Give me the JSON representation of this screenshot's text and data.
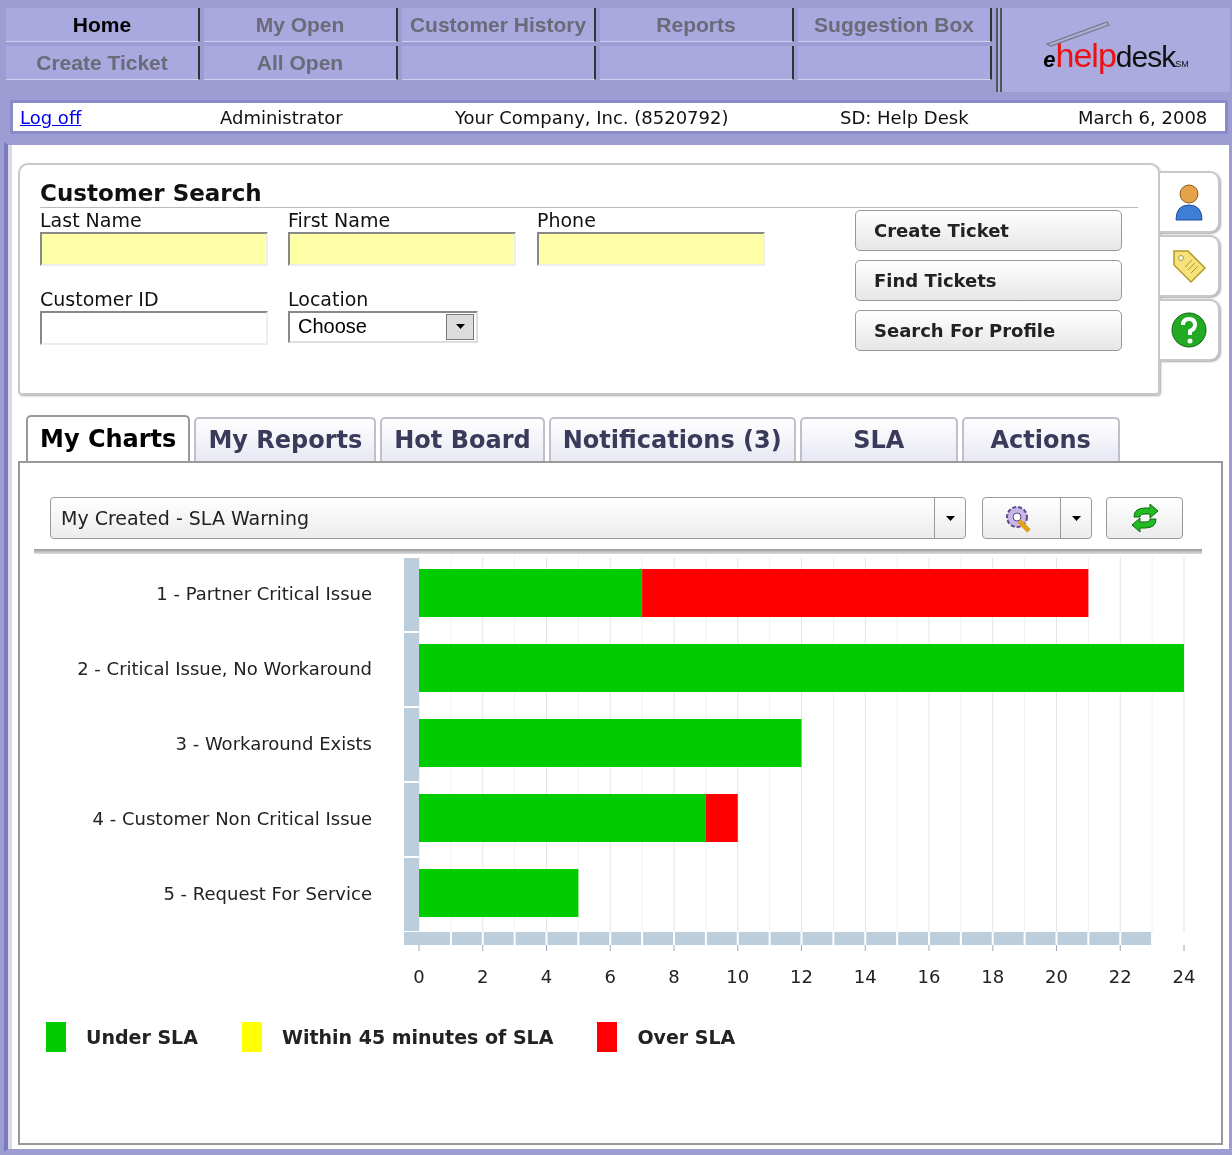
{
  "nav": {
    "rows": [
      [
        {
          "label": "Home",
          "selected": true
        },
        {
          "label": "My Open",
          "selected": false
        },
        {
          "label": "Customer History",
          "selected": false
        },
        {
          "label": "Reports",
          "selected": false
        },
        {
          "label": "Suggestion Box",
          "selected": false
        }
      ],
      [
        {
          "label": "Create Ticket",
          "selected": false
        },
        {
          "label": "All Open",
          "selected": false
        },
        null,
        null,
        null
      ]
    ],
    "logo": {
      "prefix": "e",
      "main": "help",
      "suffix": "desk",
      "mark": "SM"
    }
  },
  "info_bar": {
    "logoff": "Log off",
    "user": "Administrator",
    "company": "Your Company, Inc. (8520792)",
    "desk": "SD: Help Desk",
    "date": "March 6, 2008"
  },
  "customer_search": {
    "title": "Customer Search",
    "fields": [
      {
        "label": "Last Name",
        "kind": "text",
        "highlighted": true
      },
      {
        "label": "First Name",
        "kind": "text",
        "highlighted": true
      },
      {
        "label": "Phone",
        "kind": "text",
        "highlighted": true
      },
      {
        "label": "Customer ID",
        "kind": "text",
        "highlighted": false
      },
      {
        "label": "Location",
        "kind": "select",
        "value": "Choose",
        "highlighted": false
      }
    ],
    "buttons": [
      "Create Ticket",
      "Find Tickets",
      "Search For Profile"
    ]
  },
  "side_tabs": [
    {
      "kind": "person"
    },
    {
      "kind": "tag"
    },
    {
      "kind": "help"
    }
  ],
  "tabs": [
    {
      "label": "My Charts",
      "selected": true
    },
    {
      "label": "My Reports",
      "selected": false
    },
    {
      "label": "Hot Board",
      "selected": false
    },
    {
      "label": "Notifications (3)",
      "selected": false
    },
    {
      "label": "SLA",
      "selected": false
    },
    {
      "label": "Actions",
      "selected": false
    }
  ],
  "chart_select": {
    "value": "My Created - SLA Warning"
  },
  "chart_data": {
    "type": "bar",
    "orientation": "horizontal",
    "stacked": true,
    "grid": true,
    "categories": [
      "1 - Partner Critical Issue",
      "2 - Critical Issue, No Workaround",
      "3 - Workaround Exists",
      "4 - Customer Non Critical Issue",
      "5 - Request For Service"
    ],
    "series": [
      {
        "name": "Under SLA",
        "color": "#00cc00",
        "values": [
          7,
          24,
          12,
          9,
          5
        ]
      },
      {
        "name": "Within 45 minutes of SLA",
        "color": "#ffff00",
        "values": [
          0,
          0,
          0,
          0,
          0
        ]
      },
      {
        "name": "Over SLA",
        "color": "#ff0000",
        "values": [
          14,
          0,
          0,
          1,
          0
        ]
      }
    ],
    "xlim": [
      0,
      24
    ],
    "xticks": [
      0,
      2,
      4,
      6,
      8,
      10,
      12,
      14,
      16,
      18,
      20,
      22,
      24
    ]
  }
}
